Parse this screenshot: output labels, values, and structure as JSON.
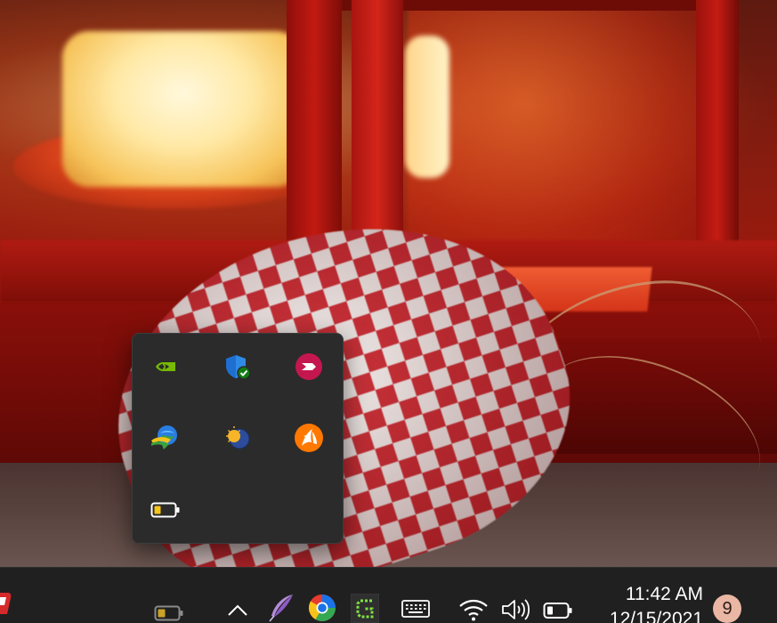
{
  "tray_overflow": {
    "icons": [
      {
        "name": "nvidia-icon",
        "tooltip": ""
      },
      {
        "name": "windows-security-icon",
        "tooltip": ""
      },
      {
        "name": "app-pink-arrow-icon",
        "tooltip": ""
      },
      {
        "name": "internet-download-manager-icon",
        "tooltip": ""
      },
      {
        "name": "weather-globe-icon",
        "tooltip": ""
      },
      {
        "name": "avast-icon",
        "tooltip": ""
      },
      {
        "name": "battery-icon",
        "tooltip": ""
      }
    ]
  },
  "taskbar": {
    "pinned": [
      {
        "name": "red-app-icon"
      },
      {
        "name": "battery-status-icon"
      },
      {
        "name": "show-hidden-icons-chevron"
      },
      {
        "name": "feather-pen-icon"
      },
      {
        "name": "chrome-like-browser-icon"
      },
      {
        "name": "green-g-app-icon"
      }
    ],
    "system": [
      {
        "name": "touch-keyboard-icon"
      },
      {
        "name": "wifi-icon"
      },
      {
        "name": "volume-icon"
      },
      {
        "name": "battery-icon"
      }
    ],
    "clock": {
      "time": "11:42 AM",
      "date": "12/15/2021"
    },
    "notification_badge": "9"
  },
  "colors": {
    "taskbar_bg": "#202020",
    "flyout_bg": "#2b2b2b",
    "badge_bg": "#e9b7a4",
    "accent_green": "#107c10",
    "nvidia_green": "#76b900",
    "avast_orange": "#ff7800"
  }
}
